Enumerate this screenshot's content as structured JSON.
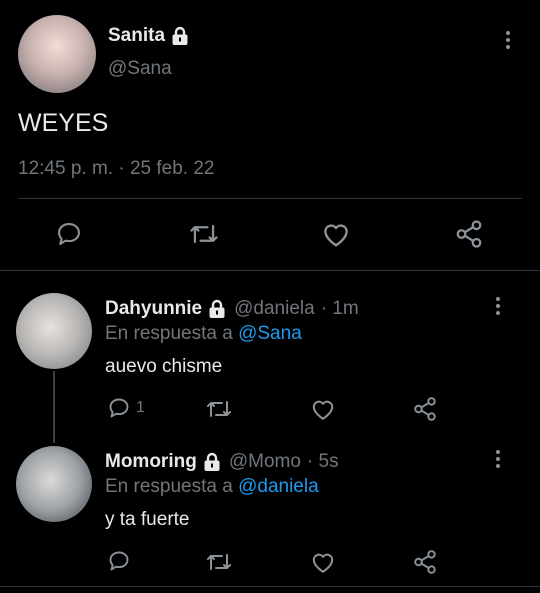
{
  "main_tweet": {
    "name": "Sanita",
    "handle": "@Sana",
    "text": "WEYES",
    "timestamp": "12:45 p. m. · 25 feb. 22"
  },
  "replies": [
    {
      "name": "Dahyunnie",
      "handle": "@daniela",
      "time": "· 1m",
      "reply_prefix": "En respuesta a",
      "reply_to": "@Sana",
      "text": "auevo chisme",
      "reply_count": "1"
    },
    {
      "name": "Momoring",
      "handle": "@Momo",
      "time": "· 5s",
      "reply_prefix": "En respuesta a",
      "reply_to": "@daniela",
      "text": "y ta fuerte",
      "reply_count": ""
    }
  ],
  "colors": {
    "background": "#000000",
    "text": "#e7e9ea",
    "muted": "#71767b",
    "link": "#1d9bf0",
    "divider": "#2f3336"
  },
  "icons": [
    "lock-icon",
    "more-icon",
    "reply-icon",
    "retweet-icon",
    "like-icon",
    "share-icon"
  ]
}
